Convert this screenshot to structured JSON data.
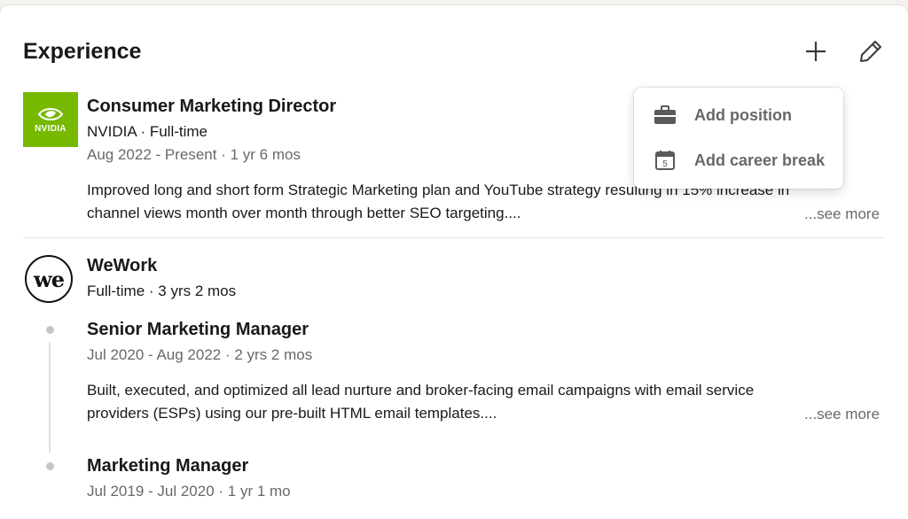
{
  "section": {
    "title": "Experience",
    "add_icon": "plus-icon",
    "edit_icon": "pencil-icon"
  },
  "add_menu": {
    "items": [
      {
        "label": "Add position",
        "icon": "briefcase-icon"
      },
      {
        "label": "Add career break",
        "icon": "calendar-icon",
        "icon_text": "5"
      }
    ]
  },
  "experiences": [
    {
      "company_logo_text": "NVIDIA",
      "title": "Consumer Marketing Director",
      "company": "NVIDIA · Full-time",
      "dates": "Aug 2022 - Present · 1 yr 6 mos",
      "description_line1": "Improved long and short form Strategic Marketing plan and YouTube strategy resulting in 15% increase in",
      "description_line2": "channel views month over month through better SEO targeting....",
      "see_more": "...see more"
    },
    {
      "company_logo_text": "we",
      "company": "WeWork",
      "tenure": "Full-time · 3 yrs 2 mos",
      "positions": [
        {
          "title": "Senior Marketing Manager",
          "dates": "Jul 2020 - Aug 2022 · 2 yrs 2 mos",
          "description_line1": "Built, executed, and optimized all lead nurture and broker-facing email campaigns with email service",
          "description_line2": "providers (ESPs) using our pre-built HTML email templates....",
          "see_more": "...see more"
        },
        {
          "title": "Marketing Manager",
          "dates": "Jul 2019 - Jul 2020 · 1 yr 1 mo"
        }
      ]
    }
  ],
  "colors": {
    "nvidia_green": "#76b900",
    "text_primary": "#191919",
    "text_secondary": "rgba(0,0,0,0.6)"
  }
}
